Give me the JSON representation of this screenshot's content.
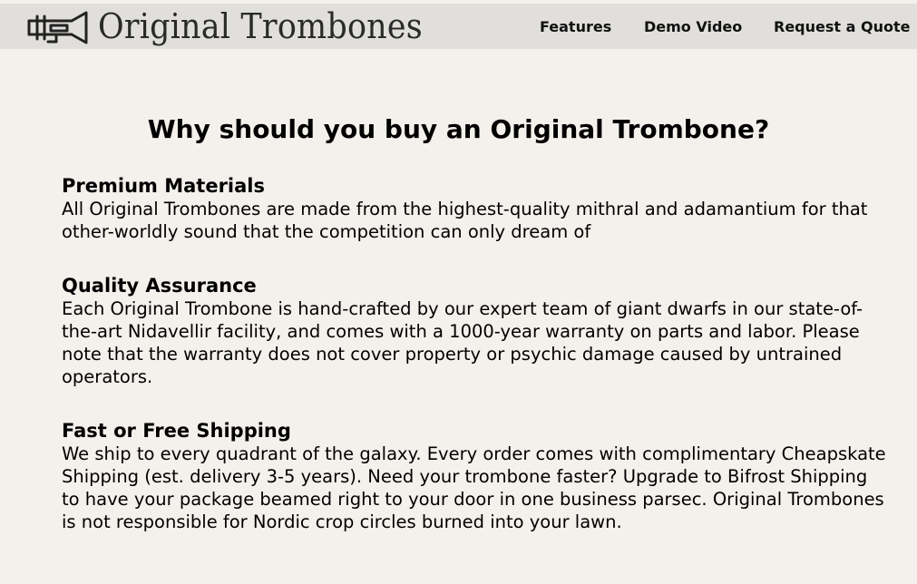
{
  "header": {
    "brand": "Original Trombones",
    "logo_icon": "trombone-icon",
    "nav": {
      "features": "Features",
      "demo_video": "Demo Video",
      "request_quote": "Request a Quote"
    }
  },
  "main": {
    "title": "Why should you buy an Original Trombone?",
    "features": [
      {
        "heading": "Premium Materials",
        "text": "All Original Trombones are made from the highest-quality mithral and adamantium for that other-worldly sound that the competition can only dream of"
      },
      {
        "heading": "Quality Assurance",
        "text": "Each Original Trombone is hand-crafted by our expert team of giant dwarfs in our state-of-the-art Nidavellir facility, and comes with a 1000-year warranty on parts and labor. Please note that the warranty does not cover property or psychic damage caused by untrained operators."
      },
      {
        "heading": "Fast or Free Shipping",
        "text": "We ship to every quadrant of the galaxy. Every order comes with complimentary Cheapskate Shipping (est. delivery 3-5 years). Need your trombone faster? Upgrade to Bifrost Shipping to have your package beamed right to your door in one business parsec. Original Trombones is not responsible for Nordic crop circles burned into your lawn."
      }
    ]
  },
  "colors": {
    "page_background": "#f4f1ec",
    "header_background": "#e1dfdc",
    "text": "#000000"
  }
}
